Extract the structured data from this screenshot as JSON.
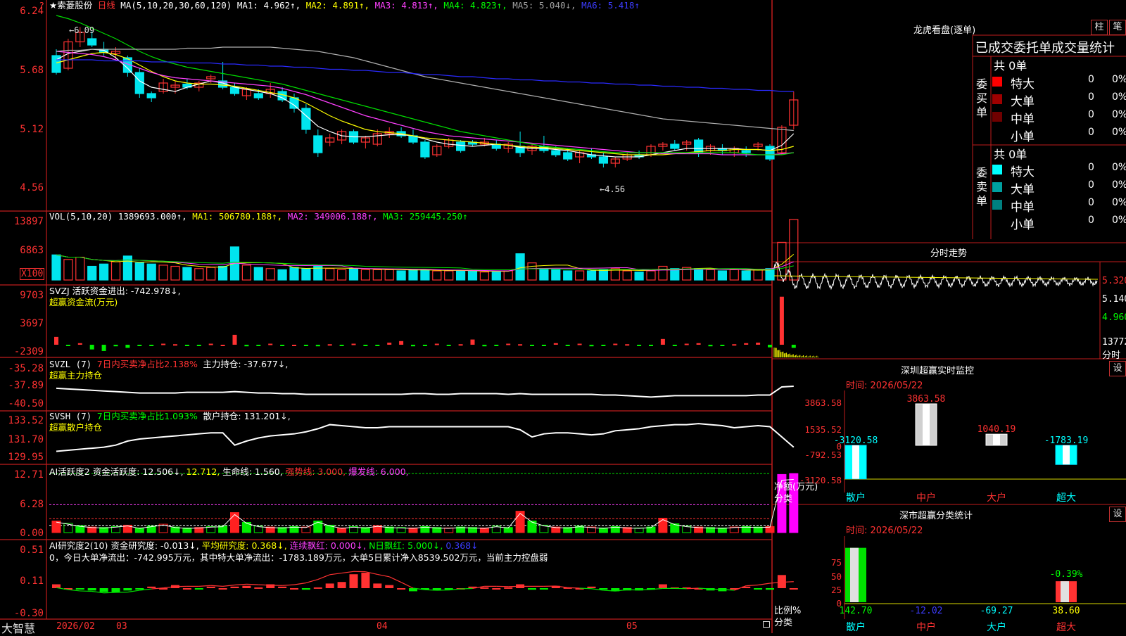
{
  "colors": {
    "up": "#ff3232",
    "down": "#00e5ee",
    "ma1": "#ffffff",
    "ma2": "#ffff00",
    "ma3": "#ff40ff",
    "ma4": "#00dd00",
    "ma5": "#b0b0b0",
    "ma6": "#2a2aff",
    "grid": "#b01818"
  },
  "header": {
    "star_icon": "star-icon",
    "stock_name": "★索菱股份",
    "period": "日线",
    "ma_params": "MA(5,10,20,30,60,120)",
    "ma1": "MA1: 4.962↑,",
    "ma2": "MA2: 4.891↑,",
    "ma3": "MA3: 4.813↑,",
    "ma4": "MA4: 4.823↑,",
    "ma5": "MA5: 5.040↓,",
    "ma6": "MA6: 5.418↑"
  },
  "price_panel": {
    "y_ticks": [
      "6.24",
      "5.68",
      "5.12",
      "4.56"
    ],
    "high_label": "6.09",
    "low_label": "4.56",
    "candles": [
      [
        5.82,
        5.88,
        5.64,
        5.66
      ],
      [
        5.7,
        5.98,
        5.68,
        5.95
      ],
      [
        5.95,
        6.09,
        5.9,
        6.04
      ],
      [
        5.98,
        6.05,
        5.9,
        5.92
      ],
      [
        5.88,
        5.95,
        5.82,
        5.85
      ],
      [
        5.84,
        5.9,
        5.78,
        5.86
      ],
      [
        5.8,
        5.82,
        5.62,
        5.66
      ],
      [
        5.66,
        5.7,
        5.42,
        5.46
      ],
      [
        5.46,
        5.48,
        5.38,
        5.42
      ],
      [
        5.48,
        5.6,
        5.46,
        5.56
      ],
      [
        5.52,
        5.58,
        5.46,
        5.54
      ],
      [
        5.55,
        5.6,
        5.5,
        5.52
      ],
      [
        5.52,
        5.58,
        5.48,
        5.56
      ],
      [
        5.6,
        5.64,
        5.56,
        5.62
      ],
      [
        5.58,
        5.76,
        5.5,
        5.52
      ],
      [
        5.52,
        5.56,
        5.44,
        5.46
      ],
      [
        5.44,
        5.52,
        5.4,
        5.5
      ],
      [
        5.46,
        5.5,
        5.4,
        5.42
      ],
      [
        5.46,
        5.56,
        5.42,
        5.5
      ],
      [
        5.48,
        5.52,
        5.38,
        5.4
      ],
      [
        5.42,
        5.46,
        5.28,
        5.32
      ],
      [
        5.32,
        5.36,
        5.08,
        5.12
      ],
      [
        5.06,
        5.12,
        4.86,
        4.9
      ],
      [
        5.0,
        5.08,
        4.96,
        5.04
      ],
      [
        5.02,
        5.12,
        4.98,
        5.1
      ],
      [
        5.1,
        5.12,
        4.98,
        5.0
      ],
      [
        5.0,
        5.06,
        4.94,
        5.04
      ],
      [
        4.98,
        5.12,
        4.96,
        5.08
      ],
      [
        5.08,
        5.14,
        5.04,
        5.1
      ],
      [
        5.1,
        5.14,
        5.04,
        5.06
      ],
      [
        5.06,
        5.12,
        4.98,
        5.0
      ],
      [
        5.0,
        5.02,
        4.84,
        4.86
      ],
      [
        4.88,
        4.98,
        4.86,
        4.96
      ],
      [
        4.96,
        5.04,
        4.94,
        5.02
      ],
      [
        5.0,
        5.02,
        4.9,
        4.92
      ],
      [
        5.0,
        5.02,
        4.96,
        4.98
      ],
      [
        4.98,
        5.04,
        4.96,
        5.0
      ],
      [
        4.98,
        5.02,
        4.92,
        4.94
      ],
      [
        4.94,
        5.0,
        4.9,
        4.98
      ],
      [
        4.96,
        5.1,
        4.86,
        4.9
      ],
      [
        4.92,
        4.98,
        4.88,
        4.96
      ],
      [
        4.96,
        5.06,
        4.9,
        4.92
      ],
      [
        4.92,
        4.96,
        4.86,
        4.88
      ],
      [
        4.9,
        4.94,
        4.82,
        4.84
      ],
      [
        4.86,
        4.92,
        4.8,
        4.9
      ],
      [
        4.88,
        4.94,
        4.84,
        4.86
      ],
      [
        4.86,
        4.9,
        4.76,
        4.8
      ],
      [
        4.8,
        4.86,
        4.76,
        4.84
      ],
      [
        4.84,
        4.9,
        4.82,
        4.88
      ],
      [
        4.88,
        4.92,
        4.84,
        4.86
      ],
      [
        4.88,
        4.98,
        4.86,
        4.96
      ],
      [
        4.96,
        5.0,
        4.92,
        4.98
      ],
      [
        4.98,
        5.02,
        4.92,
        4.94
      ],
      [
        4.98,
        5.02,
        4.92,
        5.0
      ],
      [
        5.02,
        5.04,
        4.86,
        4.9
      ],
      [
        4.92,
        4.98,
        4.88,
        4.96
      ],
      [
        4.94,
        4.98,
        4.88,
        4.92
      ],
      [
        4.9,
        4.96,
        4.86,
        4.94
      ],
      [
        4.92,
        4.96,
        4.86,
        4.9
      ],
      [
        4.96,
        5.0,
        4.92,
        4.98
      ],
      [
        4.96,
        4.98,
        4.82,
        4.84
      ],
      [
        4.9,
        5.16,
        4.88,
        5.14
      ],
      [
        5.16,
        5.48,
        5.12,
        5.4
      ]
    ],
    "ma": {
      "ma1": [
        5.78,
        5.84,
        5.86,
        5.88,
        5.87,
        5.8,
        5.7,
        5.58,
        5.52,
        5.5,
        5.48,
        5.52,
        5.55,
        5.58,
        5.56,
        5.52,
        5.5,
        5.48,
        5.46,
        5.42,
        5.35,
        5.25,
        5.15,
        5.1,
        5.06,
        5.05,
        5.05,
        5.06,
        5.07,
        5.07,
        5.06,
        5.03,
        5.0,
        4.98,
        4.97,
        4.96,
        4.97,
        4.98,
        4.97,
        4.95,
        4.94,
        4.94,
        4.93,
        4.92,
        4.9,
        4.88,
        4.87,
        4.86,
        4.86,
        4.86,
        4.88,
        4.9,
        4.92,
        4.94,
        4.94,
        4.94,
        4.94,
        4.94,
        4.93,
        4.93,
        4.92,
        4.97,
        5.08
      ],
      "ma2": [
        5.75,
        5.78,
        5.81,
        5.84,
        5.85,
        5.83,
        5.79,
        5.73,
        5.67,
        5.62,
        5.58,
        5.56,
        5.55,
        5.55,
        5.54,
        5.53,
        5.51,
        5.49,
        5.47,
        5.45,
        5.42,
        5.37,
        5.31,
        5.25,
        5.2,
        5.16,
        5.12,
        5.1,
        5.09,
        5.08,
        5.06,
        5.04,
        5.03,
        5.02,
        5.01,
        5.0,
        4.99,
        4.98,
        4.97,
        4.96,
        4.95,
        4.95,
        4.94,
        4.93,
        4.92,
        4.91,
        4.9,
        4.89,
        4.88,
        4.88,
        4.88,
        4.88,
        4.89,
        4.9,
        4.91,
        4.92,
        4.92,
        4.93,
        4.93,
        4.93,
        4.92,
        4.93,
        4.96
      ],
      "ma3": [
        5.86,
        5.85,
        5.84,
        5.83,
        5.81,
        5.78,
        5.74,
        5.7,
        5.66,
        5.63,
        5.61,
        5.6,
        5.59,
        5.58,
        5.57,
        5.56,
        5.55,
        5.54,
        5.53,
        5.51,
        5.48,
        5.45,
        5.41,
        5.37,
        5.33,
        5.29,
        5.25,
        5.22,
        5.19,
        5.16,
        5.13,
        5.1,
        5.08,
        5.06,
        5.05,
        5.04,
        5.03,
        5.02,
        5.01,
        5.0,
        4.99,
        4.98,
        4.97,
        4.96,
        4.95,
        4.94,
        4.93,
        4.92,
        4.91,
        4.9,
        4.9,
        4.89,
        4.89,
        4.89,
        4.89,
        4.89,
        4.88,
        4.88,
        4.88,
        4.88,
        4.88,
        4.89,
        4.9
      ],
      "ma4": [
        6.2,
        6.17,
        6.13,
        6.08,
        6.03,
        5.98,
        5.92,
        5.86,
        5.81,
        5.77,
        5.74,
        5.71,
        5.69,
        5.67,
        5.65,
        5.63,
        5.61,
        5.59,
        5.57,
        5.55,
        5.52,
        5.49,
        5.46,
        5.43,
        5.4,
        5.37,
        5.34,
        5.31,
        5.28,
        5.25,
        5.22,
        5.19,
        5.16,
        5.13,
        5.1,
        5.08,
        5.06,
        5.04,
        5.02,
        5.0,
        4.98,
        4.96,
        4.95,
        4.94,
        4.93,
        4.92,
        4.91,
        4.9,
        4.9,
        4.9,
        4.9,
        4.9,
        4.9,
        4.9,
        4.9,
        4.9,
        4.9,
        4.9,
        4.89,
        4.88,
        4.88,
        4.88,
        4.9
      ],
      "ma5": [
        5.86,
        5.87,
        5.87,
        5.88,
        5.88,
        5.88,
        5.88,
        5.88,
        5.88,
        5.88,
        5.88,
        5.89,
        5.89,
        5.89,
        5.9,
        5.9,
        5.9,
        5.9,
        5.9,
        5.89,
        5.88,
        5.87,
        5.86,
        5.84,
        5.82,
        5.8,
        5.77,
        5.74,
        5.71,
        5.68,
        5.65,
        5.62,
        5.6,
        5.58,
        5.56,
        5.54,
        5.52,
        5.5,
        5.48,
        5.46,
        5.44,
        5.42,
        5.4,
        5.38,
        5.36,
        5.34,
        5.32,
        5.3,
        5.28,
        5.26,
        5.24,
        5.22,
        5.21,
        5.2,
        5.19,
        5.18,
        5.17,
        5.16,
        5.15,
        5.14,
        5.13,
        5.12,
        5.11
      ],
      "ma6": [
        5.78,
        5.78,
        5.78,
        5.78,
        5.77,
        5.77,
        5.77,
        5.77,
        5.76,
        5.76,
        5.76,
        5.75,
        5.75,
        5.75,
        5.74,
        5.74,
        5.73,
        5.73,
        5.72,
        5.72,
        5.71,
        5.71,
        5.7,
        5.69,
        5.69,
        5.68,
        5.68,
        5.67,
        5.66,
        5.66,
        5.65,
        5.64,
        5.64,
        5.63,
        5.62,
        5.62,
        5.61,
        5.6,
        5.6,
        5.59,
        5.59,
        5.58,
        5.58,
        5.57,
        5.57,
        5.56,
        5.56,
        5.55,
        5.55,
        5.54,
        5.54,
        5.53,
        5.53,
        5.52,
        5.52,
        5.51,
        5.51,
        5.5,
        5.5,
        5.49,
        5.49,
        5.48,
        5.48
      ]
    }
  },
  "volume_panel": {
    "header": "VOL(5,10,20)",
    "value": "1389693.000↑,",
    "ma1": "MA1: 506780.188↑,",
    "ma2": "MA2: 349006.188↑,",
    "ma3": "MA3: 259445.250↑",
    "y_ticks": [
      "13897",
      "6863"
    ],
    "unit": "X100",
    "bars": [
      2.2,
      1.8,
      2.0,
      1.2,
      1.4,
      1.6,
      2.1,
      1.5,
      1.4,
      1.3,
      1.2,
      1.1,
      1.0,
      1.1,
      1.2,
      2.9,
      1.3,
      1.1,
      1.0,
      0.9,
      1.1,
      1.0,
      1.2,
      1.0,
      0.9,
      1.0,
      0.9,
      0.9,
      0.9,
      0.8,
      0.9,
      0.9,
      0.8,
      0.8,
      0.8,
      0.8,
      0.7,
      0.7,
      0.8,
      2.3,
      1.5,
      1.0,
      0.9,
      0.8,
      0.8,
      0.8,
      0.9,
      1.0,
      0.8,
      0.7,
      0.8,
      1.2,
      1.0,
      1.1,
      1.0,
      0.9,
      0.8,
      0.9,
      0.8,
      0.9,
      1.0,
      3.3,
      5.3
    ]
  },
  "svzj_panel": {
    "title": "SVZJ 活跃资金进出: -742.978↓,",
    "subtitle": "超赢资金流(万元)",
    "y_ticks": [
      "9703",
      "3697",
      "-2309"
    ],
    "values": [
      1500,
      -200,
      300,
      -900,
      -1200,
      -300,
      -600,
      -200,
      -100,
      200,
      100,
      -200,
      -100,
      200,
      0,
      1900,
      -300,
      -100,
      200,
      -200,
      0,
      -200,
      -300,
      100,
      -100,
      200,
      -200,
      -100,
      400,
      700,
      -300,
      -100,
      200,
      -200,
      100,
      1000,
      -300,
      -200,
      200,
      100,
      -100,
      -200,
      300,
      -100,
      200,
      -300,
      -100,
      200,
      100,
      -200,
      -100,
      1100,
      -100,
      200,
      300,
      -300,
      -200,
      100,
      300,
      400,
      -500,
      9200,
      -600
    ]
  },
  "svzl_panel": {
    "title": "SVZL (7)",
    "ratio": "7日内买卖净占比2.138%",
    "pos": "主力持仓: -37.677↓,",
    "subtitle": "超赢主力持仓",
    "y_ticks": [
      "-35.28",
      "-37.89",
      "-40.50"
    ],
    "values": [
      -38.4,
      -38.5,
      -38.6,
      -38.7,
      -38.8,
      -38.9,
      -39.0,
      -39.1,
      -39.1,
      -39.1,
      -39.1,
      -39.0,
      -39.0,
      -39.0,
      -39.0,
      -38.9,
      -39.0,
      -39.1,
      -39.1,
      -39.2,
      -39.2,
      -39.3,
      -39.3,
      -39.3,
      -39.3,
      -39.3,
      -39.3,
      -39.3,
      -39.3,
      -39.3,
      -39.2,
      -39.2,
      -39.3,
      -39.3,
      -39.2,
      -39.2,
      -39.2,
      -39.2,
      -39.3,
      -39.2,
      -39.3,
      -39.3,
      -39.3,
      -39.3,
      -39.3,
      -39.3,
      -39.4,
      -39.4,
      -39.5,
      -39.6,
      -39.7,
      -39.6,
      -39.5,
      -39.5,
      -39.5,
      -39.5,
      -39.5,
      -39.5,
      -39.5,
      -39.4,
      -39.4,
      -38.2,
      -38.1
    ]
  },
  "svsh_panel": {
    "title": "SVSH (7)",
    "ratio": "7日内买卖净占比1.093%",
    "pos": "散户持仓: 131.201↓,",
    "subtitle": "超赢散户持仓",
    "y_ticks": [
      "133.52",
      "131.70",
      "129.95"
    ],
    "values": [
      130.4,
      130.5,
      130.6,
      130.7,
      130.8,
      131.0,
      131.4,
      131.6,
      131.7,
      131.8,
      131.9,
      132.0,
      132.1,
      132.2,
      132.2,
      131.0,
      131.4,
      131.7,
      131.9,
      132.0,
      132.1,
      132.3,
      132.6,
      133.0,
      132.9,
      132.8,
      132.7,
      132.7,
      132.8,
      132.8,
      132.8,
      132.8,
      132.8,
      132.8,
      132.8,
      132.8,
      132.8,
      132.8,
      132.8,
      132.5,
      131.8,
      132.1,
      132.2,
      132.2,
      132.1,
      132.0,
      132.1,
      132.4,
      132.5,
      132.6,
      132.8,
      132.9,
      133.0,
      133.0,
      133.1,
      133.0,
      132.9,
      132.7,
      132.8,
      132.9,
      132.8,
      131.8,
      130.8
    ]
  },
  "ai_active_panel": {
    "title": "AI活跃度2",
    "a": "资金活跃度: 12.506↓,",
    "b": "12.712,",
    "c": "生命线: 1.560,",
    "d": "强势线: 3.000,",
    "e": "爆发线: 6.000,",
    "y_ticks": [
      "12.71",
      "6.28",
      "0.00"
    ],
    "values": [
      2.5,
      2.0,
      1.5,
      1.2,
      1.1,
      1.3,
      1.6,
      1.0,
      1.4,
      1.8,
      1.2,
      1.0,
      1.1,
      1.3,
      1.4,
      4.3,
      2.2,
      1.4,
      1.2,
      1.1,
      1.3,
      1.2,
      2.5,
      1.6,
      1.0,
      1.3,
      1.1,
      1.5,
      1.2,
      1.1,
      1.0,
      1.3,
      1.1,
      1.0,
      1.2,
      1.1,
      1.0,
      1.4,
      1.1,
      4.6,
      2.5,
      1.6,
      1.2,
      1.1,
      1.4,
      1.2,
      1.0,
      1.3,
      1.1,
      1.0,
      1.2,
      3.1,
      1.9,
      1.4,
      1.2,
      1.1,
      1.0,
      1.2,
      1.3,
      1.2,
      1.3,
      12.5,
      12.7
    ]
  },
  "ai_research_panel": {
    "title": "AI研究度2(10)",
    "a": "资金研究度: -0.013↓,",
    "b": "平均研究度: 0.368↓,",
    "c": "连续飘红: 0.000↓,",
    "d": "N日飘红: 5.000↓,",
    "e": "0.368↓",
    "line2": "0，今日大单净流出：-742.995万元，其中特大单净流出：-1783.189万元，大单5日累计净入8539.502万元，当前主力控盘弱",
    "y_ticks": [
      "0.51",
      "0.11",
      "-0.30"
    ],
    "values": [
      0.05,
      0.0,
      -0.01,
      -0.03,
      -0.05,
      -0.05,
      -0.03,
      -0.01,
      0.02,
      0.0,
      0.04,
      0.0,
      -0.01,
      0.02,
      0.0,
      0.02,
      0.03,
      0.01,
      0.05,
      0.02,
      0.0,
      -0.02,
      0.01,
      0.06,
      0.08,
      0.18,
      0.2,
      0.06,
      0.04,
      0.0,
      -0.04,
      -0.01,
      -0.03,
      -0.02,
      0.0,
      0.02,
      0.01,
      0.0,
      0.01,
      0.05,
      -0.02,
      -0.01,
      0.03,
      0.01,
      0.0,
      0.02,
      -0.01,
      -0.04,
      -0.03,
      -0.03,
      -0.02,
      0.05,
      0.01,
      0.01,
      0.0,
      -0.03,
      -0.04,
      0.0,
      0.02,
      -0.01,
      -0.02,
      0.17,
      0.0
    ]
  },
  "date_axis": {
    "labels": [
      "2026/02",
      "03",
      "04",
      "05"
    ],
    "brand": "大智慧"
  },
  "dragon_tiger": {
    "title": "龙虎看盘(逐单)",
    "btn1": "柱",
    "btn2": "笔",
    "head": "已成交委托单成交量统计",
    "buy_label": "委买单",
    "sell_label": "委卖单",
    "buy_total": "共 0单",
    "sell_total": "共 0单",
    "buy_rows": [
      {
        "name": "特大",
        "count": "0",
        "pct": "0%",
        "color": "#ff0000"
      },
      {
        "name": "大单",
        "count": "0",
        "pct": "0%",
        "color": "#a00000"
      },
      {
        "name": "中单",
        "count": "0",
        "pct": "0%",
        "color": "#700000"
      },
      {
        "name": "小单",
        "count": "0",
        "pct": "0%",
        "color": "#000000"
      }
    ],
    "sell_rows": [
      {
        "name": "特大",
        "count": "0",
        "pct": "0%",
        "color": "#00ffff"
      },
      {
        "name": "大单",
        "count": "0",
        "pct": "0%",
        "color": "#00a0a0"
      },
      {
        "name": "中单",
        "count": "0",
        "pct": "0%",
        "color": "#008080"
      },
      {
        "name": "小单",
        "count": "0",
        "pct": "0%",
        "color": "#000000"
      }
    ]
  },
  "intraday": {
    "title": "分时走势",
    "y_ticks": [
      "5.320",
      "5.140",
      "4.960"
    ],
    "vol_label": "13772",
    "unit": "分时"
  },
  "realtime": {
    "title": "深圳超赢实时监控",
    "settings": "设",
    "time": "时间: 2026/05/22",
    "y_ticks": [
      "3863.58",
      "1535.52",
      "0",
      "-792.53",
      "-3120.58"
    ],
    "axis_label": "净额(万元)",
    "group_label": "分类",
    "categories": [
      "散户",
      "中户",
      "大户",
      "超大"
    ],
    "values": [
      -3120.58,
      3863.58,
      1040.19,
      -1783.19
    ],
    "value_labels": [
      "-3120.58",
      "3863.58",
      "1040.19",
      "-1783.19"
    ]
  },
  "classify": {
    "title": "深市超赢分类统计",
    "settings": "设",
    "time": "时间: 2026/05/22",
    "y_ticks": [
      "75",
      "50",
      "25",
      "0"
    ],
    "axis_label": "比例%",
    "group_label": "分类",
    "categories": [
      "散户",
      "中户",
      "大户",
      "超大"
    ],
    "values": [
      142.7,
      -12.02,
      -69.27,
      38.6
    ],
    "value_labels": [
      "142.70",
      "-12.02",
      "-69.27",
      "38.60"
    ],
    "top_label": "-0.39%"
  }
}
